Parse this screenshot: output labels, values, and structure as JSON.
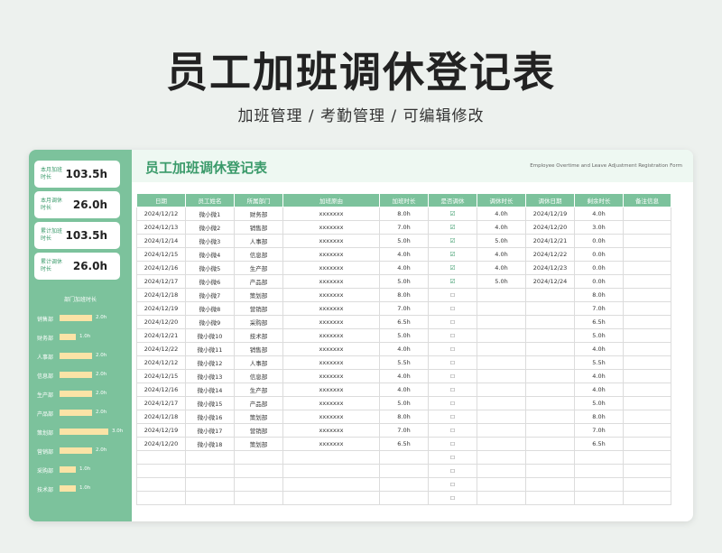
{
  "page": {
    "title": "员工加班调休登记表",
    "subtitle": "加班管理 / 考勤管理 / 可编辑修改"
  },
  "sheet": {
    "title": "员工加班调休登记表",
    "subtitle_en": "Employee Overtime and Leave Adjustment Registration Form"
  },
  "sidebar": {
    "stats": [
      {
        "label": "本月加班时长",
        "value": "103.5h"
      },
      {
        "label": "本月调休时长",
        "value": "26.0h"
      },
      {
        "label": "累计加班时长",
        "value": "103.5h"
      },
      {
        "label": "累计调休时长",
        "value": "26.0h"
      }
    ],
    "bars_title": "部门加班时长",
    "bars": [
      {
        "dept": "销售部",
        "label": "2.0h",
        "value": 2.0
      },
      {
        "dept": "财务部",
        "label": "1.0h",
        "value": 1.0
      },
      {
        "dept": "人事部",
        "label": "2.0h",
        "value": 2.0
      },
      {
        "dept": "信息部",
        "label": "2.0h",
        "value": 2.0
      },
      {
        "dept": "生产部",
        "label": "2.0h",
        "value": 2.0
      },
      {
        "dept": "产品部",
        "label": "2.0h",
        "value": 2.0
      },
      {
        "dept": "策划部",
        "label": "3.0h",
        "value": 3.0
      },
      {
        "dept": "营销部",
        "label": "2.0h",
        "value": 2.0
      },
      {
        "dept": "采购部",
        "label": "1.0h",
        "value": 1.0
      },
      {
        "dept": "技术部",
        "label": "1.0h",
        "value": 1.0
      }
    ]
  },
  "table": {
    "headers": [
      "日期",
      "员工姓名",
      "所属部门",
      "加班原由",
      "加班时长",
      "是否调休",
      "调休时长",
      "调休日期",
      "剩余时长",
      "备注信息"
    ],
    "rows": [
      [
        "2024/12/12",
        "微小微1",
        "财务部",
        "xxxxxxx",
        "8.0h",
        "checked",
        "4.0h",
        "2024/12/19",
        "4.0h",
        ""
      ],
      [
        "2024/12/13",
        "微小微2",
        "销售部",
        "xxxxxxx",
        "7.0h",
        "checked",
        "4.0h",
        "2024/12/20",
        "3.0h",
        ""
      ],
      [
        "2024/12/14",
        "微小微3",
        "人事部",
        "xxxxxxx",
        "5.0h",
        "checked",
        "5.0h",
        "2024/12/21",
        "0.0h",
        ""
      ],
      [
        "2024/12/15",
        "微小微4",
        "信息部",
        "xxxxxxx",
        "4.0h",
        "checked",
        "4.0h",
        "2024/12/22",
        "0.0h",
        ""
      ],
      [
        "2024/12/16",
        "微小微5",
        "生产部",
        "xxxxxxx",
        "4.0h",
        "checked",
        "4.0h",
        "2024/12/23",
        "0.0h",
        ""
      ],
      [
        "2024/12/17",
        "微小微6",
        "产品部",
        "xxxxxxx",
        "5.0h",
        "checked",
        "5.0h",
        "2024/12/24",
        "0.0h",
        ""
      ],
      [
        "2024/12/18",
        "微小微7",
        "策划部",
        "xxxxxxx",
        "8.0h",
        "unchecked",
        "",
        "",
        "8.0h",
        ""
      ],
      [
        "2024/12/19",
        "微小微8",
        "营销部",
        "xxxxxxx",
        "7.0h",
        "unchecked",
        "",
        "",
        "7.0h",
        ""
      ],
      [
        "2024/12/20",
        "微小微9",
        "采购部",
        "xxxxxxx",
        "6.5h",
        "unchecked",
        "",
        "",
        "6.5h",
        ""
      ],
      [
        "2024/12/21",
        "微小微10",
        "技术部",
        "xxxxxxx",
        "5.0h",
        "unchecked",
        "",
        "",
        "5.0h",
        ""
      ],
      [
        "2024/12/22",
        "微小微11",
        "销售部",
        "xxxxxxx",
        "4.0h",
        "unchecked",
        "",
        "",
        "4.0h",
        ""
      ],
      [
        "2024/12/12",
        "微小微12",
        "人事部",
        "xxxxxxx",
        "5.5h",
        "unchecked",
        "",
        "",
        "5.5h",
        ""
      ],
      [
        "2024/12/15",
        "微小微13",
        "信息部",
        "xxxxxxx",
        "4.0h",
        "unchecked",
        "",
        "",
        "4.0h",
        ""
      ],
      [
        "2024/12/16",
        "微小微14",
        "生产部",
        "xxxxxxx",
        "4.0h",
        "unchecked",
        "",
        "",
        "4.0h",
        ""
      ],
      [
        "2024/12/17",
        "微小微15",
        "产品部",
        "xxxxxxx",
        "5.0h",
        "unchecked",
        "",
        "",
        "5.0h",
        ""
      ],
      [
        "2024/12/18",
        "微小微16",
        "策划部",
        "xxxxxxx",
        "8.0h",
        "unchecked",
        "",
        "",
        "8.0h",
        ""
      ],
      [
        "2024/12/19",
        "微小微17",
        "营销部",
        "xxxxxxx",
        "7.0h",
        "unchecked",
        "",
        "",
        "7.0h",
        ""
      ],
      [
        "2024/12/20",
        "微小微18",
        "策划部",
        "xxxxxxx",
        "6.5h",
        "unchecked",
        "",
        "",
        "6.5h",
        ""
      ],
      [
        "",
        "",
        "",
        "",
        "",
        "unchecked",
        "",
        "",
        "",
        ""
      ],
      [
        "",
        "",
        "",
        "",
        "",
        "unchecked",
        "",
        "",
        "",
        ""
      ],
      [
        "",
        "",
        "",
        "",
        "",
        "unchecked",
        "",
        "",
        "",
        ""
      ],
      [
        "",
        "",
        "",
        "",
        "",
        "unchecked",
        "",
        "",
        "",
        ""
      ]
    ]
  },
  "colors": {
    "accent": "#7cc29c",
    "title_green": "#3a9a6a",
    "bar": "#fbe3a6"
  },
  "icons": {
    "checked": "checkbox-checked-icon",
    "unchecked": "checkbox-empty-icon"
  }
}
